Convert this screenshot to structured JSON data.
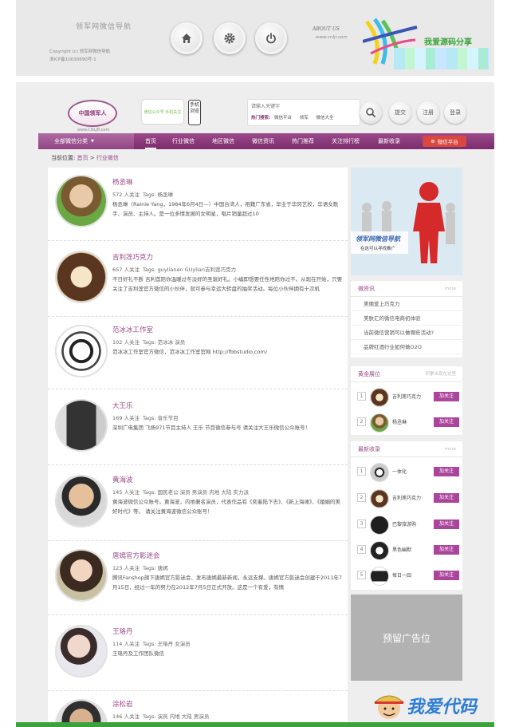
{
  "footer": {
    "logo_text": "领军网微信导航",
    "logo_sub": "",
    "copyright_line1": "Copyright (c) 领军网微信导航",
    "copyright_line2": "浙ICP备10030690号-1",
    "buttons": [
      "home-icon",
      "gear-icon",
      "power-icon"
    ],
    "about_title": "ABOUT US",
    "about_url": "www.cnljr.com",
    "share_text": "我爱源码分享"
  },
  "header": {
    "logo_text": "中国领军人",
    "logo_url": "www.CNLJR.com",
    "promo_text": "微信公众号 手机关注",
    "phone_text": "手机浏览",
    "search": {
      "placeholder": "请输入关键字",
      "hot_label": "热门搜索:",
      "hot_terms": [
        "微信平台",
        "领军",
        "微信大全"
      ]
    },
    "buttons": [
      "提交",
      "注册",
      "登录"
    ]
  },
  "nav": {
    "all_label": "全部微信分类",
    "items": [
      "首页",
      "行业微信",
      "地区微信",
      "微信资讯",
      "热门推荐",
      "关注排行榜",
      "最新收录"
    ],
    "platform_label": "微信平台"
  },
  "breadcrumb": {
    "prefix": "当前位置:",
    "home": "首页",
    "sep": ">",
    "current": "行业微信"
  },
  "list": [
    {
      "name": "杨丞琳",
      "followers": "572 人关注",
      "tags": "Tags: 杨丞琳",
      "desc": "杨丞琳（Rainie Yang，1984年6月4日—）中国台湾人，祖籍广东省，毕业于华冈艺校，华语女歌手、演员、主持人。是一位多情发展的女明星，唱片销量超过10"
    },
    {
      "name": "吉利莲巧克力",
      "followers": "657 人关注",
      "tags": "Tags: guylianen GUylian吉利莲巧克力",
      "desc": "不日好礼不断 吉利莲陪你温暖过冬淡好的圣诞好礼。小编即想要任性地陪你过不。从现在开始，只要关注了吉利莲官方微信的小伙伴，就可参与幸运大转盘的抽奖活动。每位小伙伴拥有十次机"
    },
    {
      "name": "范冰冰工作室",
      "followers": "102 人关注",
      "tags": "Tags: 范冰冰 演员",
      "desc": "范冰冰工作室官方微信，范冰冰工作室官网 http://fbbstudio.com/"
    },
    {
      "name": "大王乐",
      "followers": "169 人关注",
      "tags": "Tags: 音乐节目",
      "desc": "深圳广电集团 飞扬971节目主持人 王乐 节目微信参与号 请关注大王乐微信公众账号！"
    },
    {
      "name": "黄海波",
      "followers": "145 人关注",
      "tags": "Tags: 国民老公 演员 男演员 内地 大陆 实力派",
      "desc": "黄海波微信公众账号。黄海波，内地著名演员，代表作品有《奕着陆下去》、《新上海滩》、《婚姻的美好时代》等。 请关注黄海波微信公众账号！"
    },
    {
      "name": "唐嫣官方影迷会",
      "followers": "123 人关注",
      "tags": "Tags: 唐嫣",
      "desc": "腾讯Fanshop旗下唐嫣官方影迷会、发布唐嫣最新新闻，永远支撑。唐嫣官方影迷会创建于2011年7月15日，经过一年的努力在2012年7月5日正式开放。这是一个有爱，有情"
    },
    {
      "name": "王珞丹",
      "followers": "114 人关注",
      "tags": "Tags: 王珞丹 女演员",
      "desc": "王珞丹及工作团队微信"
    },
    {
      "name": "涂松岩",
      "followers": "146 人关注",
      "tags": "Tags: 演员 内地 大陆 男演员",
      "desc": ""
    }
  ],
  "sidebar": {
    "banner_text": "领军网微信导航",
    "banner_sub": "在这可以寻找推广",
    "news": {
      "title": "微资讯",
      "more": "more",
      "items": [
        "美丽爱上巧克力",
        "美肤汇的微信电商初体验",
        "当前微信营销可以做哪些活动?",
        "品牌红酒行业如何做O2O"
      ]
    },
    "gold": {
      "title": "黄金展位",
      "note": "积累出现在这里",
      "items": [
        {
          "num": "1",
          "name": "吉利莲巧克力",
          "btn": "加关注"
        },
        {
          "num": "2",
          "name": "杨丞琳",
          "btn": "加关注"
        }
      ]
    },
    "latest": {
      "title": "最新收录",
      "more": "more",
      "items": [
        {
          "num": "1",
          "name": "一体化",
          "btn": "加关注"
        },
        {
          "num": "2",
          "name": "吉利莲巧克力",
          "btn": "加关注"
        },
        {
          "num": "3",
          "name": "巴黎旅游购",
          "btn": "加关注"
        },
        {
          "num": "4",
          "name": "黑色幽默",
          "btn": "加关注"
        },
        {
          "num": "5",
          "name": "每日一囧",
          "btn": "加关注"
        }
      ]
    },
    "ad_text": "预留广告位"
  },
  "watermark_text": "我爱代码"
}
